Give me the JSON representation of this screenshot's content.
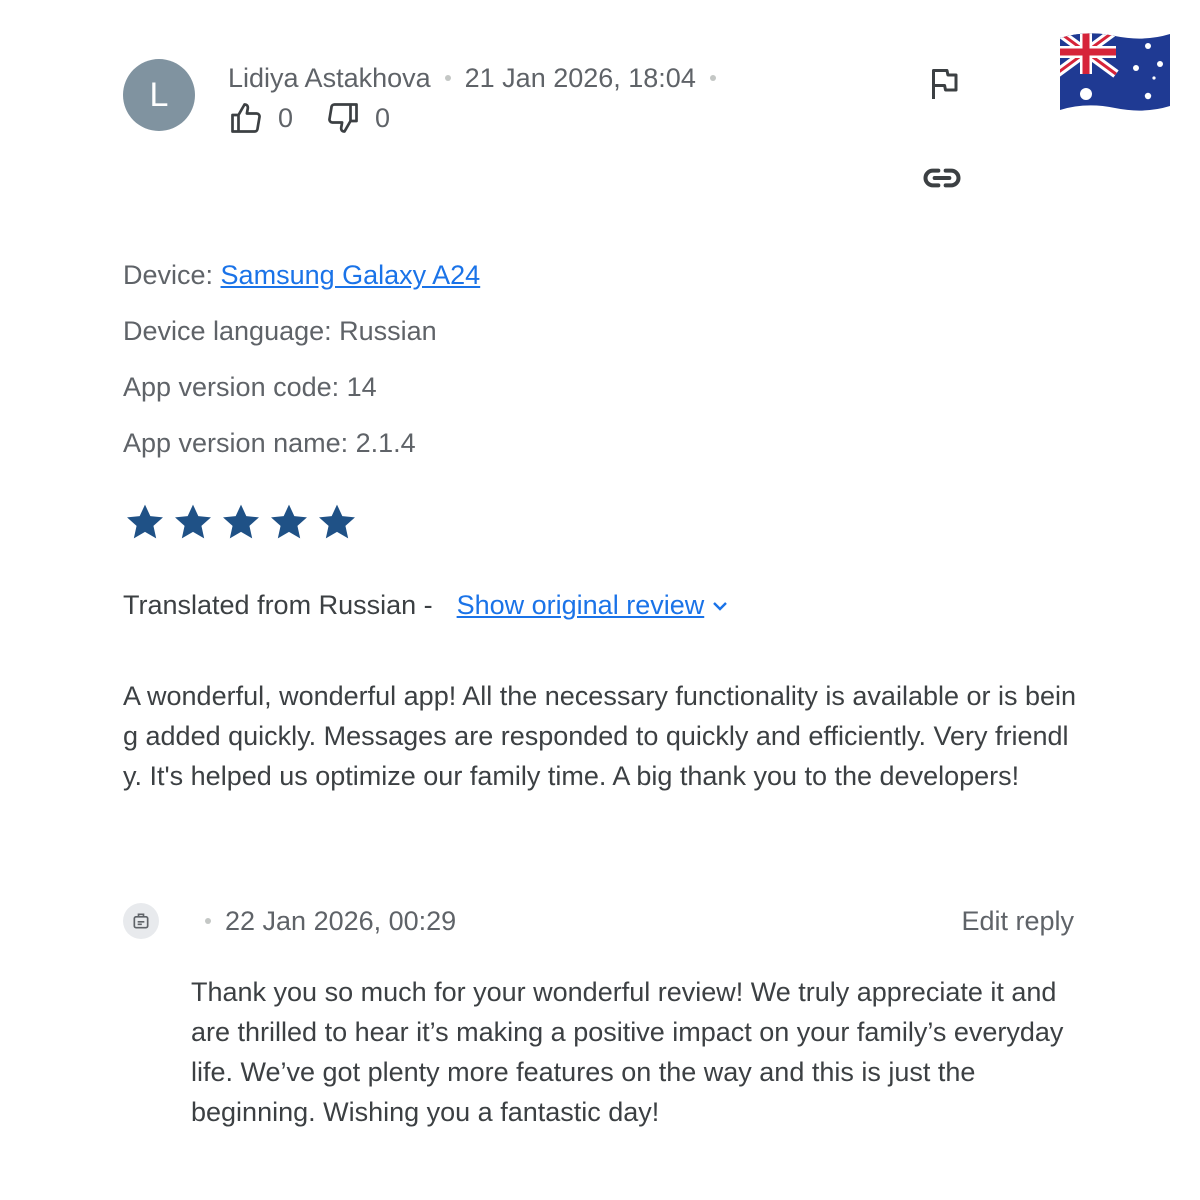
{
  "review": {
    "avatar_letter": "L",
    "author": "Lidiya Astakhova",
    "timestamp": "21 Jan 2026, 18:04",
    "thumbs_up_count": "0",
    "thumbs_down_count": "0",
    "country_flag": "australia-flag-icon"
  },
  "device_info": {
    "device_label": "Device: ",
    "device_value": "Samsung Galaxy A24",
    "language": "Device language: Russian",
    "version_code": "App version code: 14",
    "version_name": "App version name: 2.1.4"
  },
  "rating": {
    "stars": 5,
    "max": 5,
    "color": "#1f5186"
  },
  "translation": {
    "label": "Translated from Russian -",
    "link": "Show original review"
  },
  "review_text": "A wonderful, wonderful app! All the necessary functionality is available or is being added quickly. Messages are responded to quickly and efficiently. Very friendly. It's helped us optimize our family time. A big thank you to the developers!",
  "reply": {
    "timestamp": "22 Jan 2026, 00:29",
    "edit_label": "Edit reply",
    "text": "Thank you so much for your wonderful review! We truly appreciate it and are thrilled to hear it’s making a positive impact on your family’s everyday life. We’ve got plenty more features on the way and this is just the beginning. Wishing you a fantastic day!"
  },
  "colors": {
    "link": "#1a73e8",
    "avatar_bg": "#8093a0",
    "text": "#3c4043",
    "muted": "#5f6368"
  }
}
